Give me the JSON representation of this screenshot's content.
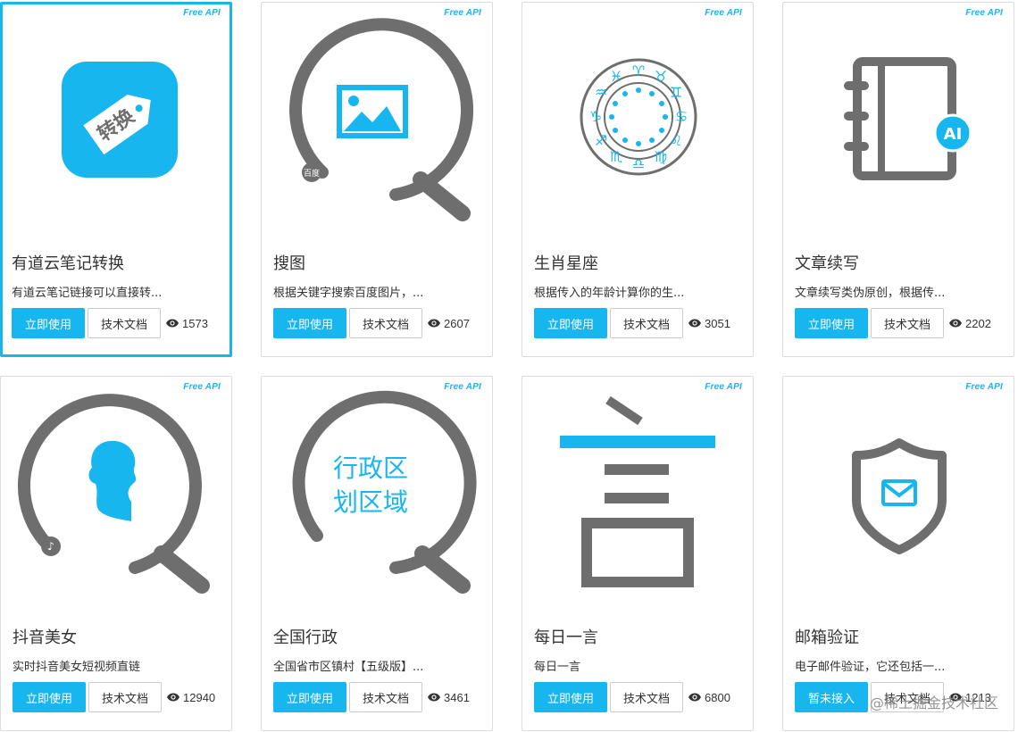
{
  "colors": {
    "accent": "#17b6ef",
    "icon_gray": "#6e6e6e",
    "border": "#dcdcdc"
  },
  "badge_label": "Free API",
  "primary_label": "立即使用",
  "docs_label": "技术文档",
  "cards": [
    {
      "title": "有道云笔记转换",
      "desc": "有道云笔记链接可以直接转...",
      "views": "1573",
      "primary": "立即使用",
      "icon_text": "转换",
      "selected": true
    },
    {
      "title": "搜图",
      "desc": "根据关键字搜索百度图片，...",
      "views": "2607",
      "primary": "立即使用",
      "icon_text": "百度"
    },
    {
      "title": "生肖星座",
      "desc": "根据传入的年龄计算你的生...",
      "views": "3051",
      "primary": "立即使用"
    },
    {
      "title": "文章续写",
      "desc": "文章续写类伪原创，根据传...",
      "views": "2202",
      "primary": "立即使用",
      "icon_text": "AI"
    },
    {
      "title": "抖音美女",
      "desc": "实时抖音美女短视频直链",
      "views": "12940",
      "primary": "立即使用"
    },
    {
      "title": "全国行政",
      "desc": "全国省市区镇村【五级版】...",
      "views": "3461",
      "primary": "立即使用",
      "icon_text_line1": "行政区",
      "icon_text_line2": "划区域"
    },
    {
      "title": "每日一言",
      "desc": "每日一言",
      "views": "6800",
      "primary": "立即使用"
    },
    {
      "title": "邮箱验证",
      "desc": "电子邮件验证，它还包括一...",
      "views": "1213",
      "primary": "暂未接入"
    }
  ],
  "watermark": "@稀土掘金技术社区"
}
